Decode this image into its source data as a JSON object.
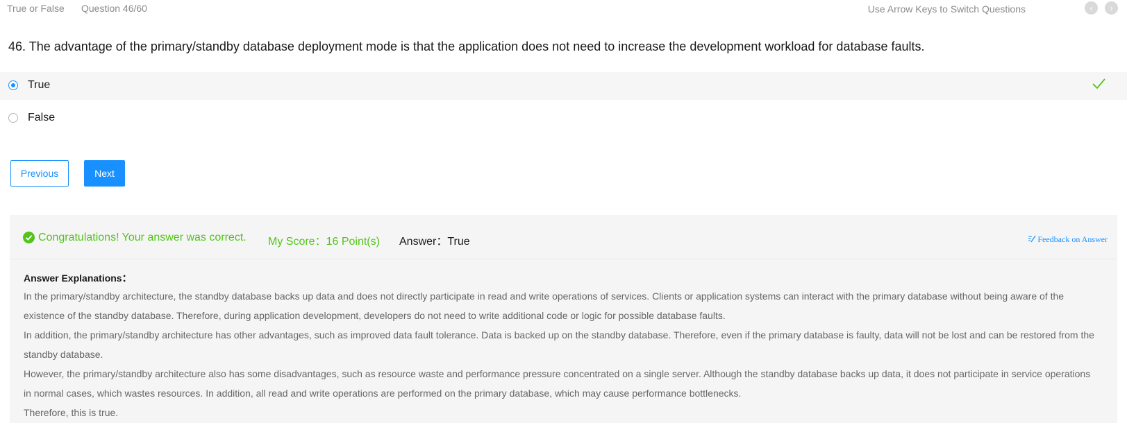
{
  "topbar": {
    "question_type": "True or False",
    "question_counter": "Question 46/60",
    "hint": "Use Arrow Keys to Switch Questions",
    "prev_icon": "chevron-left-icon",
    "next_icon": "chevron-right-icon",
    "prev_glyph": "‹",
    "next_glyph": "›"
  },
  "question": {
    "text": "46. The advantage of the primary/standby database deployment mode is that the application does not need to increase the development workload for database faults."
  },
  "options": [
    {
      "label": "True",
      "selected": true,
      "correct": true
    },
    {
      "label": "False",
      "selected": false,
      "correct": false
    }
  ],
  "buttons": {
    "previous": "Previous",
    "next": "Next"
  },
  "result": {
    "message": "Congratulations! Your answer was correct.",
    "score": "My Score：16 Point(s)",
    "answer": "Answer：True",
    "feedback": "Feedback on Answer",
    "explanation_title": "Answer Explanations：",
    "explanations": [
      "In the primary/standby architecture, the standby database backs up data and does not directly participate in read and write operations of services. Clients or application systems can interact with the primary database without being aware of the existence of the standby database. Therefore, during application development, developers do not need to write additional code or logic for possible database faults.",
      "In addition, the primary/standby architecture has other advantages, such as improved data fault tolerance. Data is backed up on the standby database. Therefore, even if the primary database is faulty, data will not be lost and can be restored from the standby database.",
      "However, the primary/standby architecture also has some disadvantages, such as resource waste and performance pressure concentrated on a single server. Although the standby database backs up data, it does not participate in service operations in normal cases, which wastes resources. In addition, all read and write operations are performed on the primary database, which may cause performance bottlenecks.",
      "Therefore, this is true."
    ]
  },
  "colors": {
    "accent": "#1890ff",
    "success": "#52c41a",
    "panel_bg": "#f5f5f5",
    "muted_text": "#8a8a8a"
  }
}
